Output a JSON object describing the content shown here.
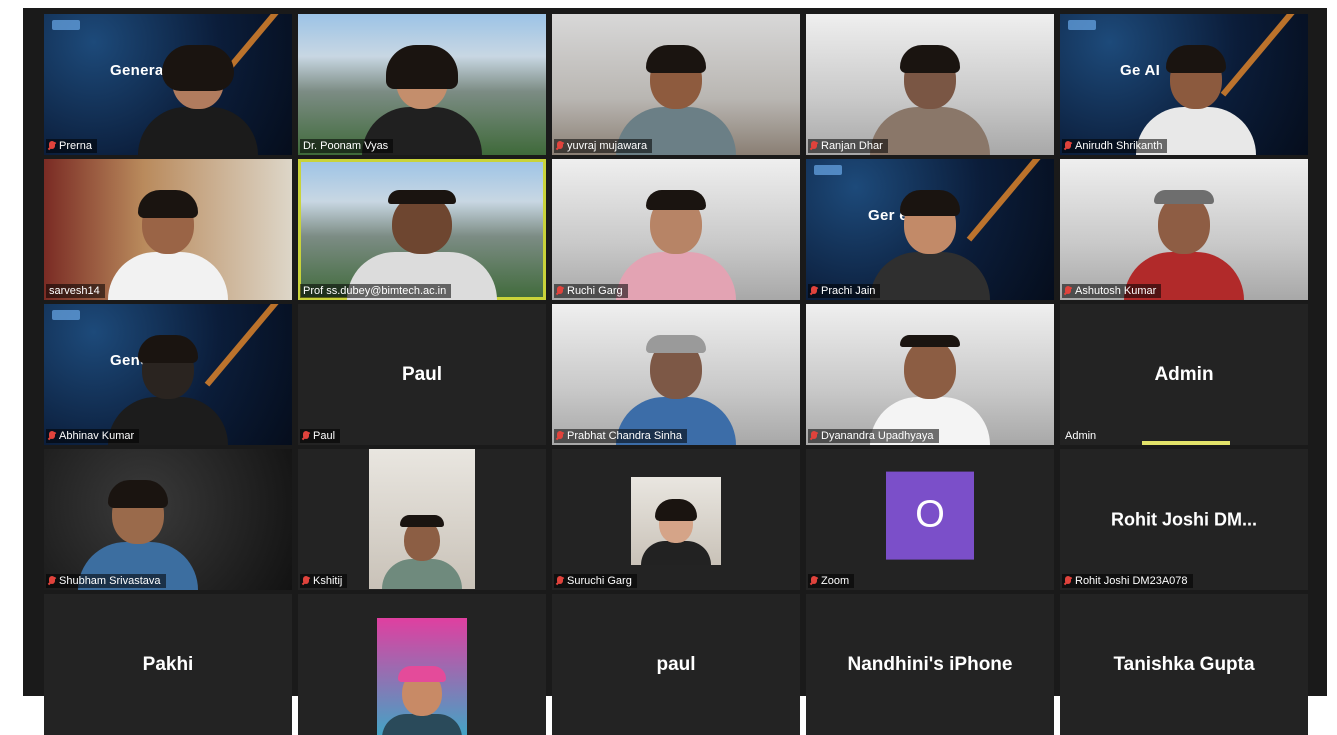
{
  "colors": {
    "gallery_bg": "#1a1a1a",
    "active_speaker_border": "#c9d33a",
    "muted_mic": "#e0433c",
    "avatar_purple": "#7b4fc9"
  },
  "background_text": {
    "generative_ai_1": "Genera",
    "generative_ai_5": "Ge        AI",
    "generative_ai_14": "Ger      e AI",
    "generative_ai_16": "Gene       A"
  },
  "tiles": [
    {
      "name": "Prerna",
      "muted": true
    },
    {
      "name": "Dr. Poonam Vyas",
      "muted": false
    },
    {
      "name": "yuvraj mujawara",
      "muted": true
    },
    {
      "name": "Ranjan Dhar",
      "muted": true
    },
    {
      "name": "Anirudh Shrikanth",
      "muted": true
    },
    {
      "name": "sarvesh14",
      "muted": false
    },
    {
      "name": "Prof ss.dubey@bimtech.ac.in",
      "muted": false
    },
    {
      "name": "Ruchi Garg",
      "muted": true
    },
    {
      "name": "Prachi Jain",
      "muted": true
    },
    {
      "name": "Ashutosh Kumar",
      "muted": true
    },
    {
      "name": "Abhinav Kumar",
      "muted": true
    },
    {
      "name": "Paul",
      "display": "Paul",
      "muted": true
    },
    {
      "name": "Prabhat Chandra Sinha",
      "muted": true
    },
    {
      "name": "Dyanandra Upadhyaya",
      "muted": true
    },
    {
      "name": "Admin",
      "display": "Admin",
      "muted": false
    },
    {
      "name": "Shubham Srivastava",
      "muted": true
    },
    {
      "name": "Kshitij",
      "muted": true
    },
    {
      "name": "Suruchi Garg",
      "muted": true
    },
    {
      "name": "Zoom",
      "avatar_letter": "O",
      "muted": true
    },
    {
      "name": "Rohit Joshi DM23A078",
      "display": "Rohit  Joshi  DM...",
      "muted": true
    },
    {
      "display": "Pakhi"
    },
    {
      "display": ""
    },
    {
      "display": "paul"
    },
    {
      "display": "Nandhini's iPhone"
    },
    {
      "display": "Tanishka Gupta"
    }
  ]
}
